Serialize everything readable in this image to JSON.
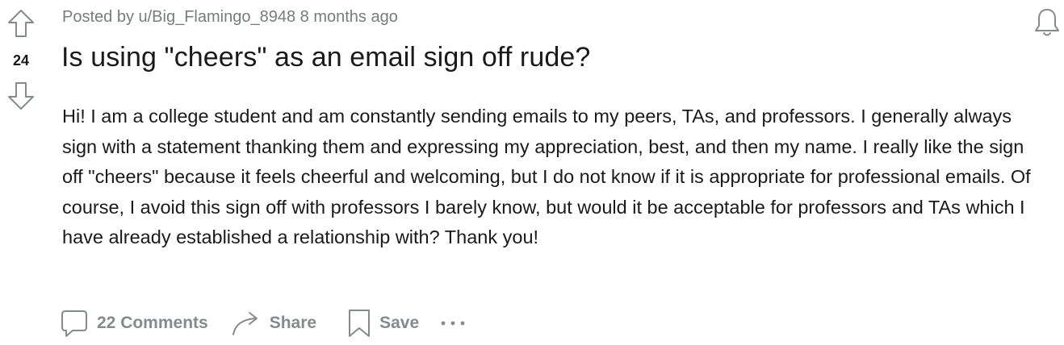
{
  "post": {
    "vote_count": "24",
    "meta": "Posted by u/Big_Flamingo_8948 8 months ago",
    "title": "Is using \"cheers\" as an email sign off rude?",
    "body": "Hi! I am a college student and am constantly sending emails to my peers, TAs, and professors. I generally always sign with a statement thanking them and expressing my appreciation, best, and then my name. I really like the sign off \"cheers\" because it feels cheerful and welcoming, but I do not know if it is appropriate for professional emails. Of course, I avoid this sign off with professors I barely know, but would it be acceptable for professors and TAs which I have already established a relationship with? Thank you!"
  },
  "actions": {
    "comments_label": "22 Comments",
    "share_label": "Share",
    "save_label": "Save"
  },
  "icons": {
    "upvote": "arrow-up-outline-icon",
    "downvote": "arrow-down-outline-icon",
    "notifications": "bell-icon",
    "comments": "speech-bubble-icon",
    "share": "curved-arrow-icon",
    "save": "bookmark-icon",
    "more": "horizontal-ellipsis-icon"
  },
  "colors": {
    "text_primary": "#1a1a1b",
    "text_muted": "#787c7e",
    "action_gray": "#878a8c"
  }
}
